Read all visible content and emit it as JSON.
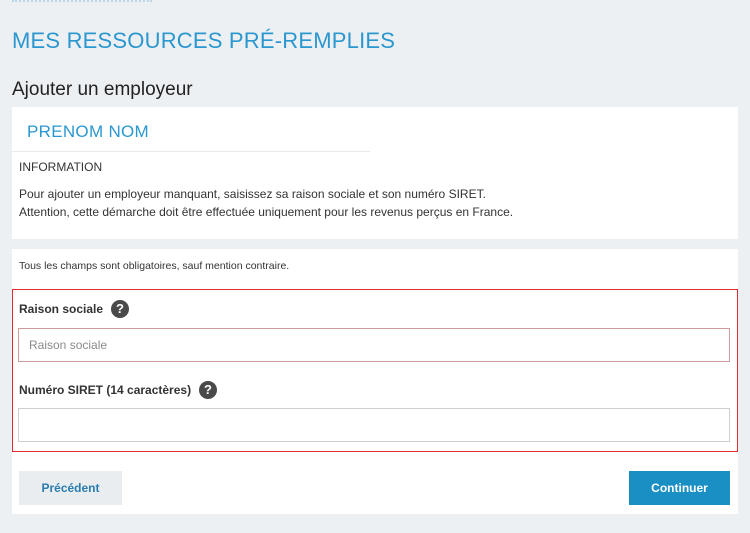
{
  "header": {
    "page_title": "MES RESSOURCES PRÉ-REMPLIES",
    "section_title": "Ajouter un employeur"
  },
  "info_panel": {
    "person_name": "PRENOM NOM",
    "heading": "INFORMATION",
    "line1": "Pour ajouter un employeur manquant, saisissez sa raison sociale et son numéro SIRET.",
    "line2": "Attention, cette démarche doit être effectuée uniquement pour les revenus perçus en France."
  },
  "form": {
    "mandatory_note": "Tous les champs sont obligatoires, sauf mention contraire.",
    "raison_sociale": {
      "label": "Raison sociale",
      "placeholder": "Raison sociale",
      "value": "",
      "help_icon": "question-circle-icon"
    },
    "siret": {
      "label": "Numéro SIRET (14 caractères)",
      "placeholder": "",
      "value": "",
      "help_icon": "question-circle-icon"
    }
  },
  "actions": {
    "previous_label": "Précédent",
    "continue_label": "Continuer"
  },
  "colors": {
    "accent": "#2a97cf",
    "primary_button": "#1a8fc4",
    "highlight_border": "#e22a2f",
    "background": "#edf0f3"
  }
}
